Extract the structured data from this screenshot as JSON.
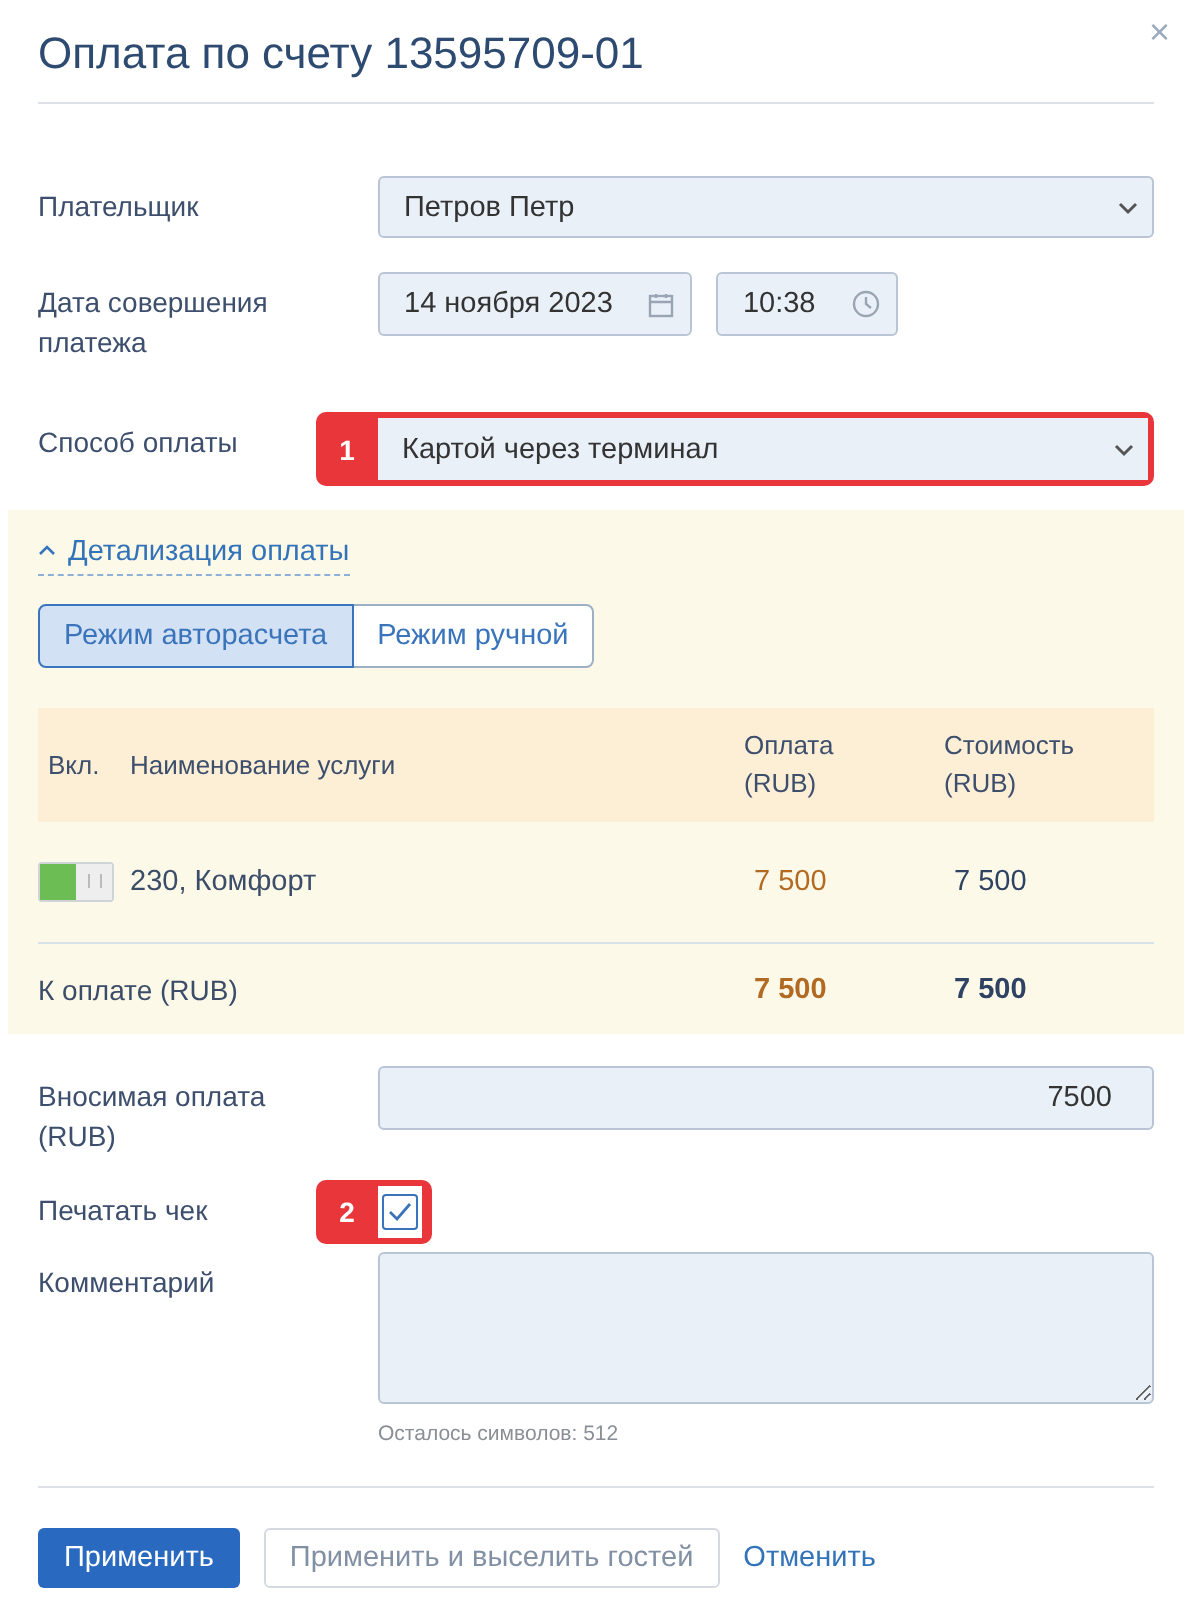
{
  "dialog": {
    "title": "Оплата по счету 13595709-01",
    "close": "×"
  },
  "payer": {
    "label": "Плательщик",
    "value": "Петров Петр"
  },
  "date": {
    "label": "Дата совершения платежа",
    "date": "14 ноября 2023",
    "time": "10:38"
  },
  "method": {
    "label": "Способ оплаты",
    "value": "Картой через терминал",
    "callout": "1"
  },
  "details": {
    "toggle": "Детализация оплаты",
    "expanded": true,
    "modes": [
      {
        "label": "Режим авторасчета",
        "selected": true
      },
      {
        "label": "Режим ручной",
        "selected": false
      }
    ],
    "columns": [
      "Вкл.",
      "Наименование услуги",
      "Оплата (RUB)",
      "Стоимость (RUB)"
    ],
    "rows": [
      {
        "on": true,
        "name": "230, Комфорт",
        "payment": "7 500",
        "cost": "7 500"
      }
    ],
    "total": {
      "label": "К оплате (RUB)",
      "payment": "7 500",
      "cost": "7 500"
    }
  },
  "amount": {
    "label": "Вносимая оплата (RUB)",
    "value": "7500"
  },
  "print": {
    "label": "Печатать чек",
    "checked": true,
    "callout": "2"
  },
  "comment": {
    "label": "Комментарий",
    "hint": "Осталось символов: 512"
  },
  "buttons": [
    {
      "label": "Применить",
      "kind": "primary"
    },
    {
      "label": "Применить и выселить гостей",
      "kind": "secondary"
    },
    {
      "label": "Отменить",
      "kind": "link"
    }
  ]
}
